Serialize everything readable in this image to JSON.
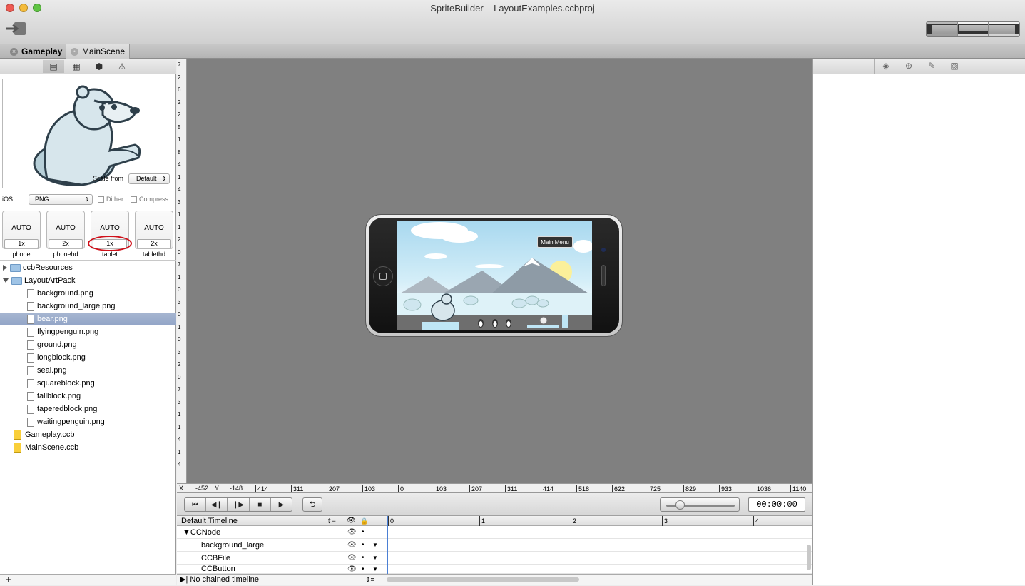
{
  "window": {
    "title": "SpriteBuilder – LayoutExamples.ccbproj"
  },
  "tabs": [
    {
      "label": "Gameplay"
    },
    {
      "label": "MainScene"
    }
  ],
  "preview": {
    "scale_from_label": "Scale from",
    "scale_from_value": "Default"
  },
  "publish": {
    "platform": "iOS",
    "format": "PNG",
    "dither_label": "Dither",
    "compress_label": "Compress"
  },
  "resolutions": [
    {
      "auto": "AUTO",
      "scale": "1x",
      "label": "phone"
    },
    {
      "auto": "AUTO",
      "scale": "2x",
      "label": "phonehd"
    },
    {
      "auto": "AUTO",
      "scale": "1x",
      "label": "tablet"
    },
    {
      "auto": "AUTO",
      "scale": "2x",
      "label": "tablethd"
    }
  ],
  "files": {
    "folders": [
      "ccbResources",
      "LayoutArtPack"
    ],
    "items": [
      "background.png",
      "background_large.png",
      "bear.png",
      "flyingpenguin.png",
      "ground.png",
      "longblock.png",
      "seal.png",
      "squareblock.png",
      "tallblock.png",
      "taperedblock.png",
      "waitingpenguin.png"
    ],
    "ccb": [
      "Gameplay.ccb",
      "MainScene.ccb"
    ],
    "selected": "bear.png"
  },
  "left_bottom": {
    "add": "+"
  },
  "scene": {
    "main_menu_label": "Main Menu"
  },
  "ruler": {
    "x_label": "X",
    "x_value": "-452",
    "y_label": "Y",
    "y_value": "-148",
    "h_ticks": [
      "414",
      "311",
      "207",
      "103",
      "0",
      "103",
      "207",
      "311",
      "414",
      "518",
      "622",
      "725",
      "829",
      "933",
      "1036",
      "1140"
    ],
    "v_ticks": [
      "7",
      "2",
      "6",
      "2",
      "2",
      "5",
      "1",
      "8",
      "4",
      "1",
      "4",
      "3",
      "1",
      "1",
      "2",
      "0",
      "7",
      "1",
      "0",
      "3",
      "0",
      "1",
      "0",
      "3",
      "2",
      "0",
      "7",
      "3",
      "1",
      "1",
      "4",
      "1",
      "4"
    ]
  },
  "playback": {
    "timecode": "00:00:00",
    "zoom_level": 0.2
  },
  "timeline": {
    "name": "Default Timeline",
    "marks": [
      "0",
      "1",
      "2",
      "3",
      "4"
    ],
    "rows": [
      "CCNode",
      "background_large",
      "CCBFile",
      "CCButton"
    ],
    "chained": "No chained timeline"
  }
}
